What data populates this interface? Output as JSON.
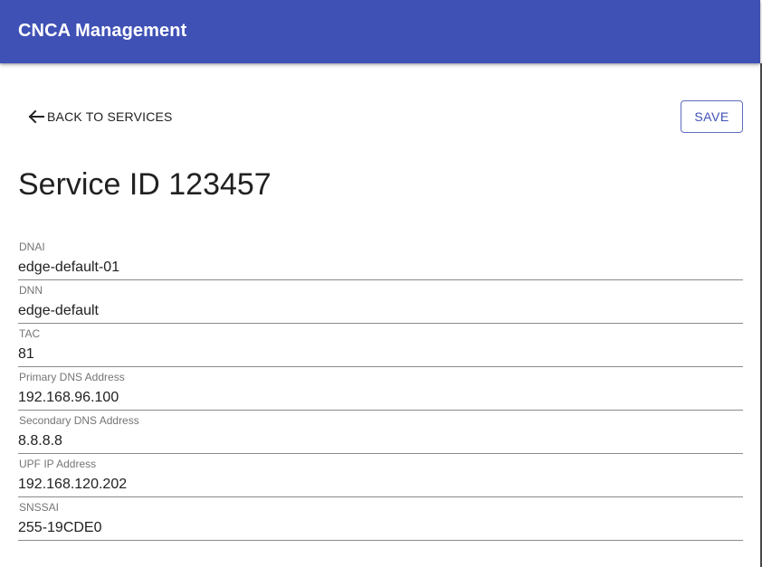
{
  "appbar": {
    "title": "CNCA Management"
  },
  "toolbar": {
    "back_label": "BACK TO SERVICES",
    "save_label": "SAVE"
  },
  "page": {
    "title": "Service ID 123457"
  },
  "fields": [
    {
      "label": "DNAI",
      "value": "edge-default-01"
    },
    {
      "label": "DNN",
      "value": "edge-default"
    },
    {
      "label": "TAC",
      "value": "81"
    },
    {
      "label": "Primary DNS Address",
      "value": "192.168.96.100"
    },
    {
      "label": "Secondary DNS Address",
      "value": "8.8.8.8"
    },
    {
      "label": "UPF IP Address",
      "value": "192.168.120.202"
    },
    {
      "label": "SNSSAI",
      "value": "255-19CDE0"
    }
  ],
  "colors": {
    "primary": "#3f51b5",
    "text": "#212121",
    "label": "#757575"
  }
}
